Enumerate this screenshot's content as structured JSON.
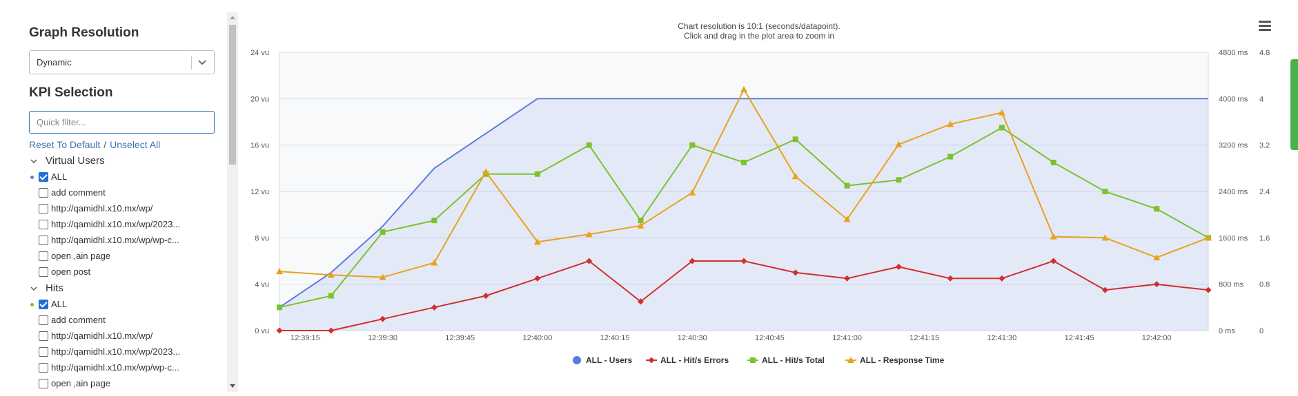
{
  "sidebar": {
    "graph_resolution_title": "Graph Resolution",
    "resolution_value": "Dynamic",
    "kpi_selection_title": "KPI Selection",
    "filter_placeholder": "Quick filter...",
    "reset_link": "Reset To Default",
    "separator": "/",
    "unselect_link": "Unselect All",
    "groups": [
      {
        "name": "Virtual Users",
        "dot_color": "#5b7be0",
        "items": [
          {
            "label": "ALL",
            "checked": true
          },
          {
            "label": "add comment",
            "checked": false
          },
          {
            "label": "http://qamidhl.x10.mx/wp/",
            "checked": false
          },
          {
            "label": "http://qamidhl.x10.mx/wp/2023...",
            "checked": false
          },
          {
            "label": "http://qamidhl.x10.mx/wp/wp-c...",
            "checked": false
          },
          {
            "label": "open ,ain page",
            "checked": false
          },
          {
            "label": "open post",
            "checked": false
          }
        ]
      },
      {
        "name": "Hits",
        "dot_color": "#7cc22c",
        "items": [
          {
            "label": "ALL",
            "checked": true
          },
          {
            "label": "add comment",
            "checked": false
          },
          {
            "label": "http://qamidhl.x10.mx/wp/",
            "checked": false
          },
          {
            "label": "http://qamidhl.x10.mx/wp/2023...",
            "checked": false
          },
          {
            "label": "http://qamidhl.x10.mx/wp/wp-c...",
            "checked": false
          },
          {
            "label": "open ,ain page",
            "checked": false
          }
        ]
      }
    ]
  },
  "chart_data": {
    "type": "line",
    "subtitle_lines": [
      "Chart resolution is 10:1 (seconds/datapoint).",
      "Click and drag in the plot area to zoom in"
    ],
    "x_ticks": [
      "12:39:15",
      "12:39:30",
      "12:39:45",
      "12:40:00",
      "12:40:15",
      "12:40:30",
      "12:40:45",
      "12:41:00",
      "12:41:15",
      "12:41:30",
      "12:41:45",
      "12:42:00"
    ],
    "y_left_ticks": [
      "0 vu",
      "4 vu",
      "8 vu",
      "12 vu",
      "16 vu",
      "20 vu",
      "24 vu"
    ],
    "y_ms_ticks": [
      "0 ms",
      "800 ms",
      "1600 ms",
      "2400 ms",
      "3200 ms",
      "4000 ms",
      "4800 ms"
    ],
    "y_hits_ticks": [
      "0",
      "0.8",
      "1.6",
      "2.4",
      "3.2",
      "4",
      "4.8"
    ],
    "ylim_vu": [
      0,
      24
    ],
    "x_range_seconds": [
      0,
      180
    ],
    "grid": true,
    "legend_position": "bottom-center",
    "series": [
      {
        "name": "ALL - Users",
        "color": "#5b7be0",
        "marker": "none",
        "area": true,
        "axis": "vu",
        "x": [
          0,
          10,
          20,
          30,
          40,
          50,
          180
        ],
        "y": [
          2,
          5,
          9,
          14,
          17,
          20,
          20
        ]
      },
      {
        "name": "ALL - Hit/s Errors",
        "color": "#d02f2f",
        "marker": "diamond",
        "axis": "hits",
        "x": [
          0,
          10,
          20,
          30,
          40,
          50,
          60,
          70,
          80,
          90,
          100,
          110,
          120,
          130,
          140,
          150,
          160,
          170,
          180
        ],
        "y": [
          0,
          0,
          0.2,
          0.4,
          0.6,
          0.9,
          1.2,
          0.5,
          1.2,
          1.2,
          1.0,
          0.9,
          1.1,
          0.9,
          0.9,
          1.2,
          0.7,
          0.8,
          0.7
        ]
      },
      {
        "name": "ALL - Hit/s Total",
        "color": "#7cc22c",
        "marker": "square",
        "axis": "hits",
        "x": [
          0,
          10,
          20,
          30,
          40,
          50,
          60,
          70,
          80,
          90,
          100,
          110,
          120,
          130,
          140,
          150,
          160,
          170,
          180
        ],
        "y": [
          0.4,
          0.6,
          1.7,
          1.9,
          2.7,
          2.7,
          3.2,
          1.9,
          3.2,
          2.9,
          3.3,
          2.5,
          2.6,
          3.0,
          3.5,
          2.9,
          2.4,
          2.1,
          1.6
        ]
      },
      {
        "name": "ALL - Response Time",
        "color": "#e8a21c",
        "marker": "triangle",
        "axis": "ms",
        "x": [
          0,
          10,
          20,
          30,
          40,
          50,
          60,
          70,
          80,
          90,
          100,
          110,
          120,
          130,
          140,
          150,
          160,
          170,
          180
        ],
        "y": [
          1020,
          960,
          920,
          1170,
          2740,
          1530,
          1660,
          1810,
          2380,
          4160,
          2660,
          1920,
          3210,
          3560,
          3760,
          1620,
          1600,
          1260,
          1600
        ]
      }
    ]
  }
}
